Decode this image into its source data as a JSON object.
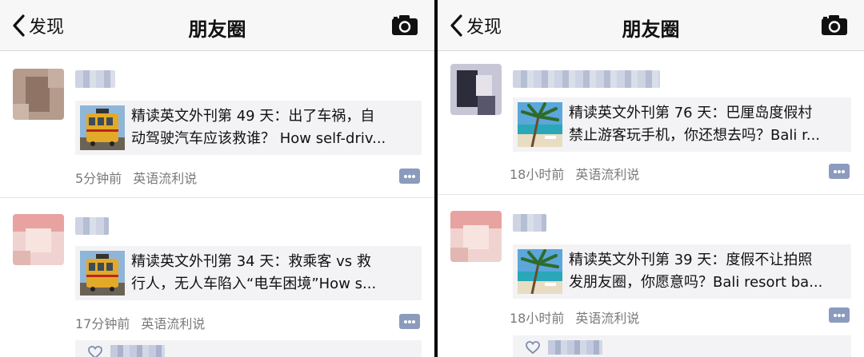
{
  "left": {
    "nav": {
      "back_label": "发现",
      "title": "朋友圈"
    },
    "posts": [
      {
        "link_line1": "精读英文外刊第 49 天：出了车祸，自",
        "link_line2": "动驾驶汽车应该救谁？ How self-driv...",
        "time": "5分钟前",
        "source": "英语流利说"
      },
      {
        "link_line1": "精读英文外刊第 34 天：救乘客 vs 救",
        "link_line2": "行人，无人车陷入“电车困境”How s...",
        "time": "17分钟前",
        "source": "英语流利说"
      }
    ]
  },
  "right": {
    "nav": {
      "back_label": "发现",
      "title": "朋友圈"
    },
    "posts": [
      {
        "link_line1": "精读英文外刊第 76 天：巴厘岛度假村",
        "link_line2": "禁止游客玩手机，你还想去吗？Bali r...",
        "time": "18小时前",
        "source": "英语流利说"
      },
      {
        "link_line1": "精读英文外刊第 39 天：度假不让拍照",
        "link_line2": "发朋友圈，你愿意吗？Bali resort ba...",
        "time": "18小时前",
        "source": "英语流利说"
      }
    ]
  },
  "icons": [
    "chevron-left-icon",
    "camera-icon",
    "comment-icon",
    "heart-icon"
  ],
  "colors": {
    "link_card_bg": "#f3f3f5",
    "meta_text": "#7a7a7a",
    "comment_btn": "#8b9bbd"
  }
}
